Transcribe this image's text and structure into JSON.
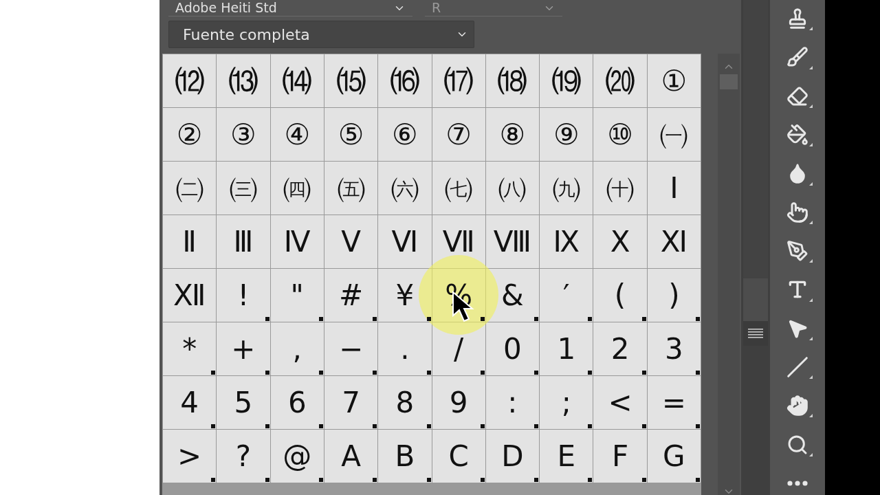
{
  "font_family": {
    "value": "Adobe Heiti Std"
  },
  "font_style": {
    "value": "R",
    "disabled": true
  },
  "glyph_set": {
    "value": "Fuente completa"
  },
  "glyph_rows": [
    {
      "cells": [
        {
          "glyph": "⑿",
          "alternates": false,
          "highlighted": false
        },
        {
          "glyph": "⒀",
          "alternates": false,
          "highlighted": false
        },
        {
          "glyph": "⒁",
          "alternates": false,
          "highlighted": false
        },
        {
          "glyph": "⒂",
          "alternates": false,
          "highlighted": false
        },
        {
          "glyph": "⒃",
          "alternates": false,
          "highlighted": false
        },
        {
          "glyph": "⒄",
          "alternates": false,
          "highlighted": false
        },
        {
          "glyph": "⒅",
          "alternates": false,
          "highlighted": false
        },
        {
          "glyph": "⒆",
          "alternates": false,
          "highlighted": false
        },
        {
          "glyph": "⒇",
          "alternates": false,
          "highlighted": false
        },
        {
          "glyph": "①",
          "alternates": false,
          "highlighted": false
        }
      ]
    },
    {
      "cells": [
        {
          "glyph": "②",
          "alternates": false,
          "highlighted": false
        },
        {
          "glyph": "③",
          "alternates": false,
          "highlighted": false
        },
        {
          "glyph": "④",
          "alternates": false,
          "highlighted": false
        },
        {
          "glyph": "⑤",
          "alternates": false,
          "highlighted": false
        },
        {
          "glyph": "⑥",
          "alternates": false,
          "highlighted": false
        },
        {
          "glyph": "⑦",
          "alternates": false,
          "highlighted": false
        },
        {
          "glyph": "⑧",
          "alternates": false,
          "highlighted": false
        },
        {
          "glyph": "⑨",
          "alternates": false,
          "highlighted": false
        },
        {
          "glyph": "⑩",
          "alternates": false,
          "highlighted": false
        },
        {
          "glyph": "㈠",
          "alternates": false,
          "highlighted": false
        }
      ]
    },
    {
      "cells": [
        {
          "glyph": "㈡",
          "alternates": false,
          "highlighted": false
        },
        {
          "glyph": "㈢",
          "alternates": false,
          "highlighted": false
        },
        {
          "glyph": "㈣",
          "alternates": false,
          "highlighted": false
        },
        {
          "glyph": "㈤",
          "alternates": false,
          "highlighted": false
        },
        {
          "glyph": "㈥",
          "alternates": false,
          "highlighted": false
        },
        {
          "glyph": "㈦",
          "alternates": false,
          "highlighted": false
        },
        {
          "glyph": "㈧",
          "alternates": false,
          "highlighted": false
        },
        {
          "glyph": "㈨",
          "alternates": false,
          "highlighted": false
        },
        {
          "glyph": "㈩",
          "alternates": false,
          "highlighted": false
        },
        {
          "glyph": "Ⅰ",
          "alternates": false,
          "highlighted": false
        }
      ]
    },
    {
      "cells": [
        {
          "glyph": "Ⅱ",
          "alternates": false,
          "highlighted": false
        },
        {
          "glyph": "Ⅲ",
          "alternates": false,
          "highlighted": false
        },
        {
          "glyph": "Ⅳ",
          "alternates": false,
          "highlighted": false
        },
        {
          "glyph": "Ⅴ",
          "alternates": false,
          "highlighted": false
        },
        {
          "glyph": "Ⅵ",
          "alternates": false,
          "highlighted": false
        },
        {
          "glyph": "Ⅶ",
          "alternates": false,
          "highlighted": false
        },
        {
          "glyph": "Ⅷ",
          "alternates": false,
          "highlighted": false
        },
        {
          "glyph": "Ⅸ",
          "alternates": false,
          "highlighted": false
        },
        {
          "glyph": "Ⅹ",
          "alternates": false,
          "highlighted": false
        },
        {
          "glyph": "Ⅺ",
          "alternates": false,
          "highlighted": false
        }
      ]
    },
    {
      "cells": [
        {
          "glyph": "Ⅻ",
          "alternates": false,
          "highlighted": false
        },
        {
          "glyph": "!",
          "alternates": true,
          "highlighted": false
        },
        {
          "glyph": "\"",
          "alternates": true,
          "highlighted": false
        },
        {
          "glyph": "#",
          "alternates": true,
          "highlighted": false
        },
        {
          "glyph": "¥",
          "alternates": true,
          "highlighted": false
        },
        {
          "glyph": "%",
          "alternates": true,
          "highlighted": true
        },
        {
          "glyph": "&",
          "alternates": true,
          "highlighted": false
        },
        {
          "glyph": "′",
          "alternates": true,
          "highlighted": false
        },
        {
          "glyph": "(",
          "alternates": true,
          "highlighted": false
        },
        {
          "glyph": ")",
          "alternates": true,
          "highlighted": false
        }
      ]
    },
    {
      "cells": [
        {
          "glyph": "*",
          "alternates": true,
          "highlighted": false
        },
        {
          "glyph": "+",
          "alternates": true,
          "highlighted": false
        },
        {
          "glyph": ",",
          "alternates": true,
          "highlighted": false
        },
        {
          "glyph": "−",
          "alternates": true,
          "highlighted": false
        },
        {
          "glyph": ".",
          "alternates": true,
          "highlighted": false
        },
        {
          "glyph": "/",
          "alternates": true,
          "highlighted": false
        },
        {
          "glyph": "0",
          "alternates": true,
          "highlighted": false
        },
        {
          "glyph": "1",
          "alternates": true,
          "highlighted": false
        },
        {
          "glyph": "2",
          "alternates": true,
          "highlighted": false
        },
        {
          "glyph": "3",
          "alternates": true,
          "highlighted": false
        }
      ]
    },
    {
      "cells": [
        {
          "glyph": "4",
          "alternates": true,
          "highlighted": false
        },
        {
          "glyph": "5",
          "alternates": true,
          "highlighted": false
        },
        {
          "glyph": "6",
          "alternates": true,
          "highlighted": false
        },
        {
          "glyph": "7",
          "alternates": true,
          "highlighted": false
        },
        {
          "glyph": "8",
          "alternates": true,
          "highlighted": false
        },
        {
          "glyph": "9",
          "alternates": true,
          "highlighted": false
        },
        {
          "glyph": ":",
          "alternates": true,
          "highlighted": false
        },
        {
          "glyph": ";",
          "alternates": true,
          "highlighted": false
        },
        {
          "glyph": "<",
          "alternates": true,
          "highlighted": false
        },
        {
          "glyph": "=",
          "alternates": true,
          "highlighted": false
        }
      ]
    },
    {
      "cells": [
        {
          "glyph": ">",
          "alternates": true,
          "highlighted": false
        },
        {
          "glyph": "?",
          "alternates": true,
          "highlighted": false
        },
        {
          "glyph": "@",
          "alternates": true,
          "highlighted": false
        },
        {
          "glyph": "A",
          "alternates": true,
          "highlighted": false
        },
        {
          "glyph": "B",
          "alternates": true,
          "highlighted": false
        },
        {
          "glyph": "C",
          "alternates": true,
          "highlighted": false
        },
        {
          "glyph": "D",
          "alternates": true,
          "highlighted": false
        },
        {
          "glyph": "E",
          "alternates": true,
          "highlighted": false
        },
        {
          "glyph": "F",
          "alternates": true,
          "highlighted": false
        },
        {
          "glyph": "G",
          "alternates": true,
          "highlighted": false
        }
      ]
    }
  ],
  "tools": [
    {
      "kind": "stamp"
    },
    {
      "kind": "brush"
    },
    {
      "kind": "eraser"
    },
    {
      "kind": "bucket"
    },
    {
      "kind": "drop"
    },
    {
      "kind": "smudge"
    },
    {
      "kind": "pen"
    },
    {
      "kind": "type"
    },
    {
      "kind": "select"
    },
    {
      "kind": "line"
    },
    {
      "kind": "hand"
    },
    {
      "kind": "zoom"
    },
    {
      "kind": "more"
    }
  ]
}
